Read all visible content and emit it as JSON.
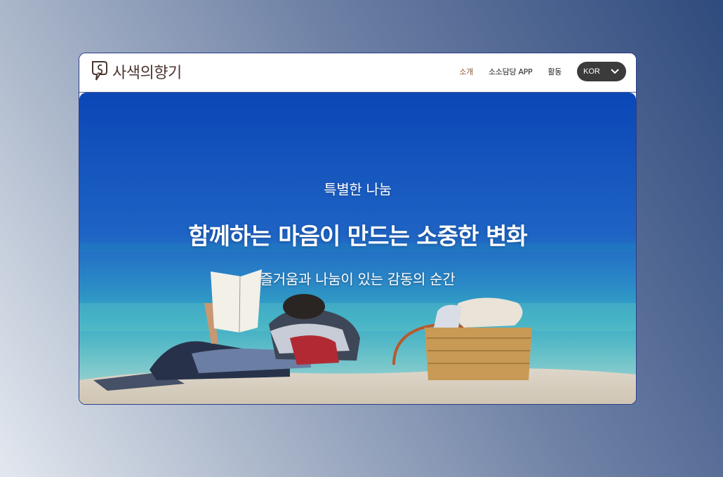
{
  "brand": {
    "name": "사색의향기",
    "logo_icon": "speech-bubble-s-icon",
    "color": "#4b3630"
  },
  "nav": {
    "items": [
      {
        "label": "소개",
        "active": true
      },
      {
        "label": "소소담당 APP",
        "active": false
      },
      {
        "label": "활동",
        "active": false
      }
    ],
    "language": {
      "label": "KOR",
      "icon": "chevron-down-icon"
    }
  },
  "hero": {
    "kicker": "특별한 나눔",
    "headline": "함께하는 마음이 만드는 소중한 변화",
    "subline": "즐거움과 나눔이 있는 감동의 순간"
  },
  "colors": {
    "active_nav": "#8a5a3c",
    "lang_pill": "#3b3b3b",
    "window_border": "#2b3e88"
  }
}
